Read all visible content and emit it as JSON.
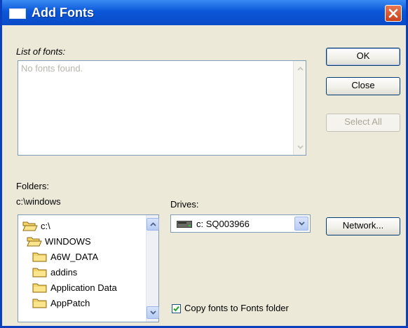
{
  "window": {
    "title": "Add Fonts",
    "close_icon": "close-icon"
  },
  "fonts": {
    "label": "List of fonts:",
    "empty_text": "No fonts found."
  },
  "folders": {
    "label": "Folders:",
    "current_path": "c:\\windows",
    "tree": [
      {
        "label": "c:\\",
        "icon": "open-folder-icon"
      },
      {
        "label": "WINDOWS",
        "icon": "open-folder-icon"
      },
      {
        "label": "A6W_DATA",
        "icon": "folder-icon"
      },
      {
        "label": "addins",
        "icon": "folder-icon"
      },
      {
        "label": "Application Data",
        "icon": "folder-icon"
      },
      {
        "label": "AppPatch",
        "icon": "folder-icon"
      }
    ]
  },
  "drives": {
    "label": "Drives:",
    "selected": "c: SQ003966",
    "icon": "drive-icon"
  },
  "buttons": {
    "ok": "OK",
    "close": "Close",
    "select_all": "Select All",
    "network": "Network..."
  },
  "copy_fonts": {
    "label": "Copy fonts to Fonts folder",
    "checked": true
  },
  "colors": {
    "titlebar": "#0b57d8",
    "dialog_bg": "#ece9d8",
    "close_button": "#d2522c",
    "folder": "#f5d469"
  }
}
